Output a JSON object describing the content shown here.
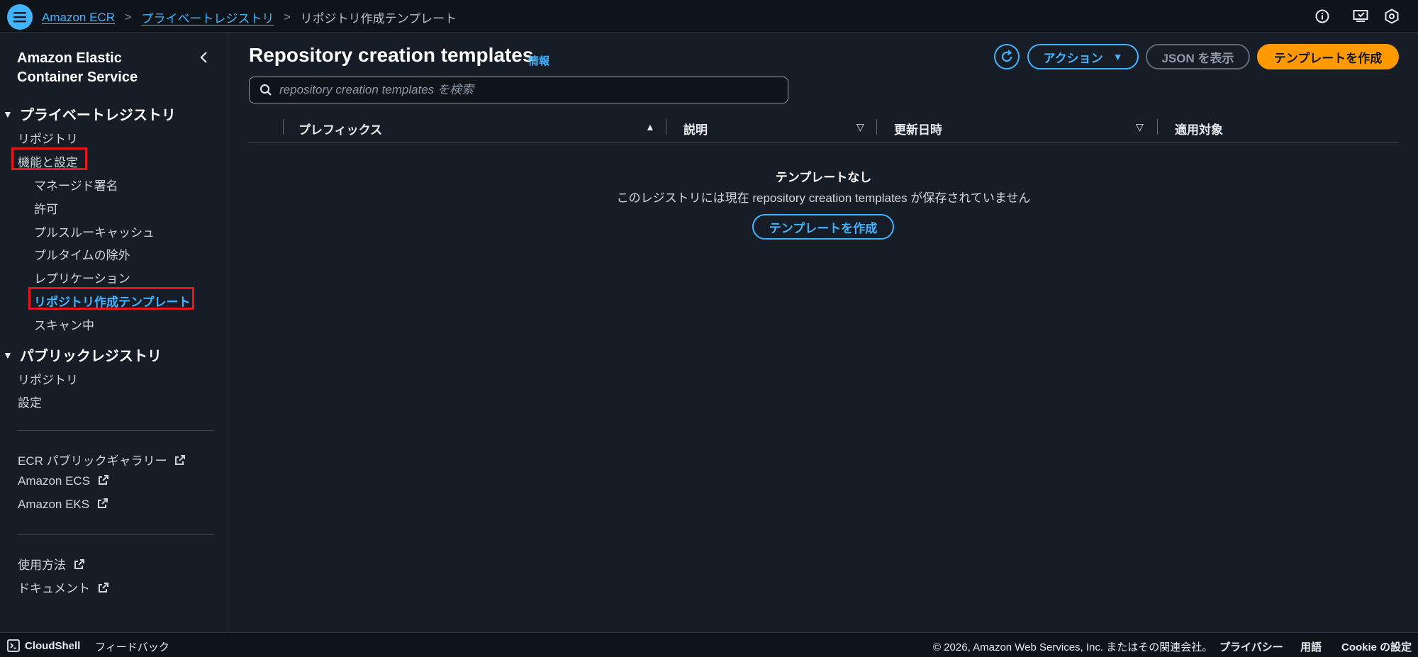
{
  "breadcrumb": {
    "items": [
      "Amazon ECR",
      "プライベートレジストリ"
    ],
    "current": "リポジトリ作成テンプレート"
  },
  "sidebar": {
    "title_line1": "Amazon Elastic",
    "title_line2": "Container Service",
    "private_registry": {
      "header": "プライベートレジストリ",
      "repositories": "リポジトリ",
      "features": "機能と設定",
      "sub": [
        "マネージド署名",
        "許可",
        "プルスルーキャッシュ",
        "プルタイムの除外",
        "レプリケーション",
        "リポジトリ作成テンプレート",
        "スキャン中"
      ]
    },
    "public_registry": {
      "header": "パブリックレジストリ",
      "repositories": "リポジトリ",
      "settings": "設定"
    },
    "links": [
      "ECR パブリックギャラリー",
      "Amazon ECS",
      "Amazon EKS"
    ],
    "help": [
      "使用方法",
      "ドキュメント"
    ]
  },
  "main": {
    "title": "Repository creation templates",
    "info": "情報",
    "actions_label": "アクション",
    "json_label": "JSON を表示",
    "create_label": "テンプレートを作成",
    "search_placeholder": "repository creation templates を検索",
    "columns": [
      "プレフィックス",
      "説明",
      "更新日時",
      "適用対象"
    ],
    "empty_title": "テンプレートなし",
    "empty_desc": "このレジストリには現在 repository creation templates が保存されていません",
    "empty_create_label": "テンプレートを作成"
  },
  "footer": {
    "cloudshell": "CloudShell",
    "feedback": "フィードバック",
    "copyright": "© 2026, Amazon Web Services, Inc. またはその関連会社。",
    "privacy": "プライバシー",
    "terms": "用語",
    "cookie": "Cookie の設定"
  },
  "colors": {
    "accent": "#42b4ff",
    "primary": "#ff9900",
    "highlight": "#e4171b",
    "background": "#161d26"
  },
  "icons": [
    "menu-icon",
    "info-icon",
    "notifications-icon",
    "settings-icon",
    "chevron-left-icon",
    "refresh-icon",
    "search-icon",
    "external-link-icon",
    "cloudshell-icon"
  ]
}
